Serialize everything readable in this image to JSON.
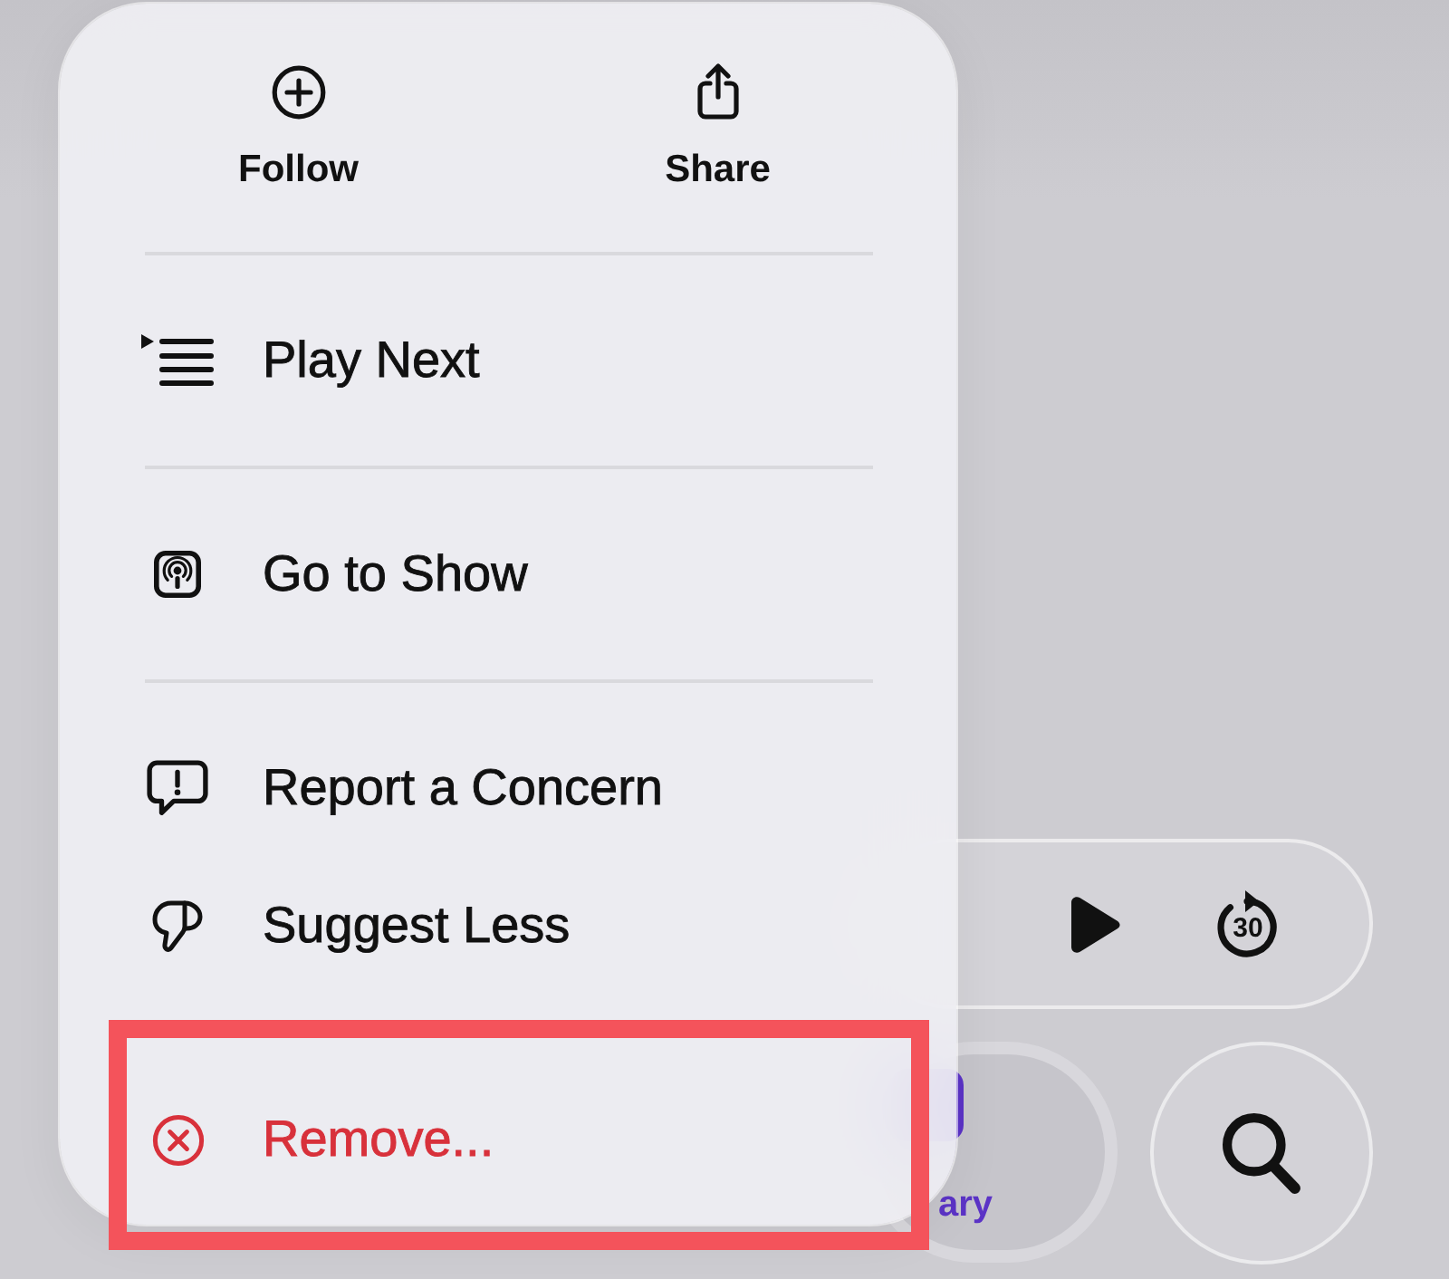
{
  "menu": {
    "actions": [
      {
        "label": "Follow"
      },
      {
        "label": "Share"
      }
    ],
    "sections": [
      {
        "items": [
          {
            "label": "Play Next",
            "destructive": false,
            "highlighted": false
          }
        ]
      },
      {
        "items": [
          {
            "label": "Go to Show",
            "destructive": false,
            "highlighted": false
          }
        ]
      },
      {
        "items": [
          {
            "label": "Report a Concern",
            "destructive": false,
            "highlighted": false
          },
          {
            "label": "Suggest Less",
            "destructive": false,
            "highlighted": false
          }
        ]
      },
      {
        "items": [
          {
            "label": "Remove...",
            "destructive": true,
            "highlighted": true
          }
        ]
      }
    ]
  },
  "mini_player": {
    "skip_label": "30"
  },
  "tab_bar": {
    "tabs": [
      {
        "label": "ary",
        "selected": true
      }
    ]
  }
}
